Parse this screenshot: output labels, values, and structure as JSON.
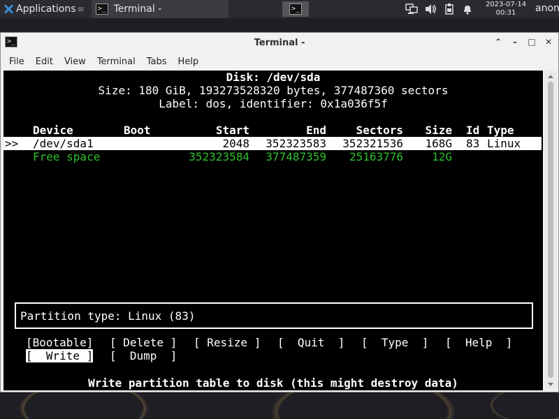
{
  "panel": {
    "applications_label": "Applications",
    "applications_sep": "≡",
    "task_title": "Terminal -",
    "clock_date": "2023-07-14",
    "clock_time": "00:31",
    "user": "anon"
  },
  "window": {
    "title": "Terminal -",
    "menu": [
      "File",
      "Edit",
      "View",
      "Terminal",
      "Tabs",
      "Help"
    ]
  },
  "cfdisk": {
    "disk_line": "Disk: /dev/sda",
    "size_line": "Size: 180 GiB, 193273528320 bytes, 377487360 sectors",
    "label_line": "Label: dos, identifier: 0x1a036f5f",
    "headers": {
      "device": "Device",
      "boot": "Boot",
      "start": "Start",
      "end": "End",
      "sectors": "Sectors",
      "size": "Size",
      "id": "Id",
      "type": "Type"
    },
    "rows": [
      {
        "marker": ">>",
        "device": "/dev/sda1",
        "boot": "",
        "start": "2048",
        "end": "352323583",
        "sectors": "352321536",
        "size": "168G",
        "id": "83",
        "type": "Linux"
      },
      {
        "marker": "",
        "device": "Free space",
        "boot": "",
        "start": "352323584",
        "end": "377487359",
        "sectors": "25163776",
        "size": "12G",
        "id": "",
        "type": ""
      }
    ],
    "status": "Partition type: Linux (83)",
    "commands": [
      "[Bootable]",
      "[ Delete ]",
      "[ Resize ]",
      "[  Quit  ]",
      "[  Type  ]",
      "[  Help  ]",
      "[  Write ]",
      "[  Dump  ]"
    ],
    "selected_command": "[  Write ]",
    "hint": "Write partition table to disk (this might destroy data)"
  },
  "colors": {
    "free_space": "#2ec02e",
    "terminal_bg": "#000000",
    "selection_bg": "#ffffff"
  }
}
